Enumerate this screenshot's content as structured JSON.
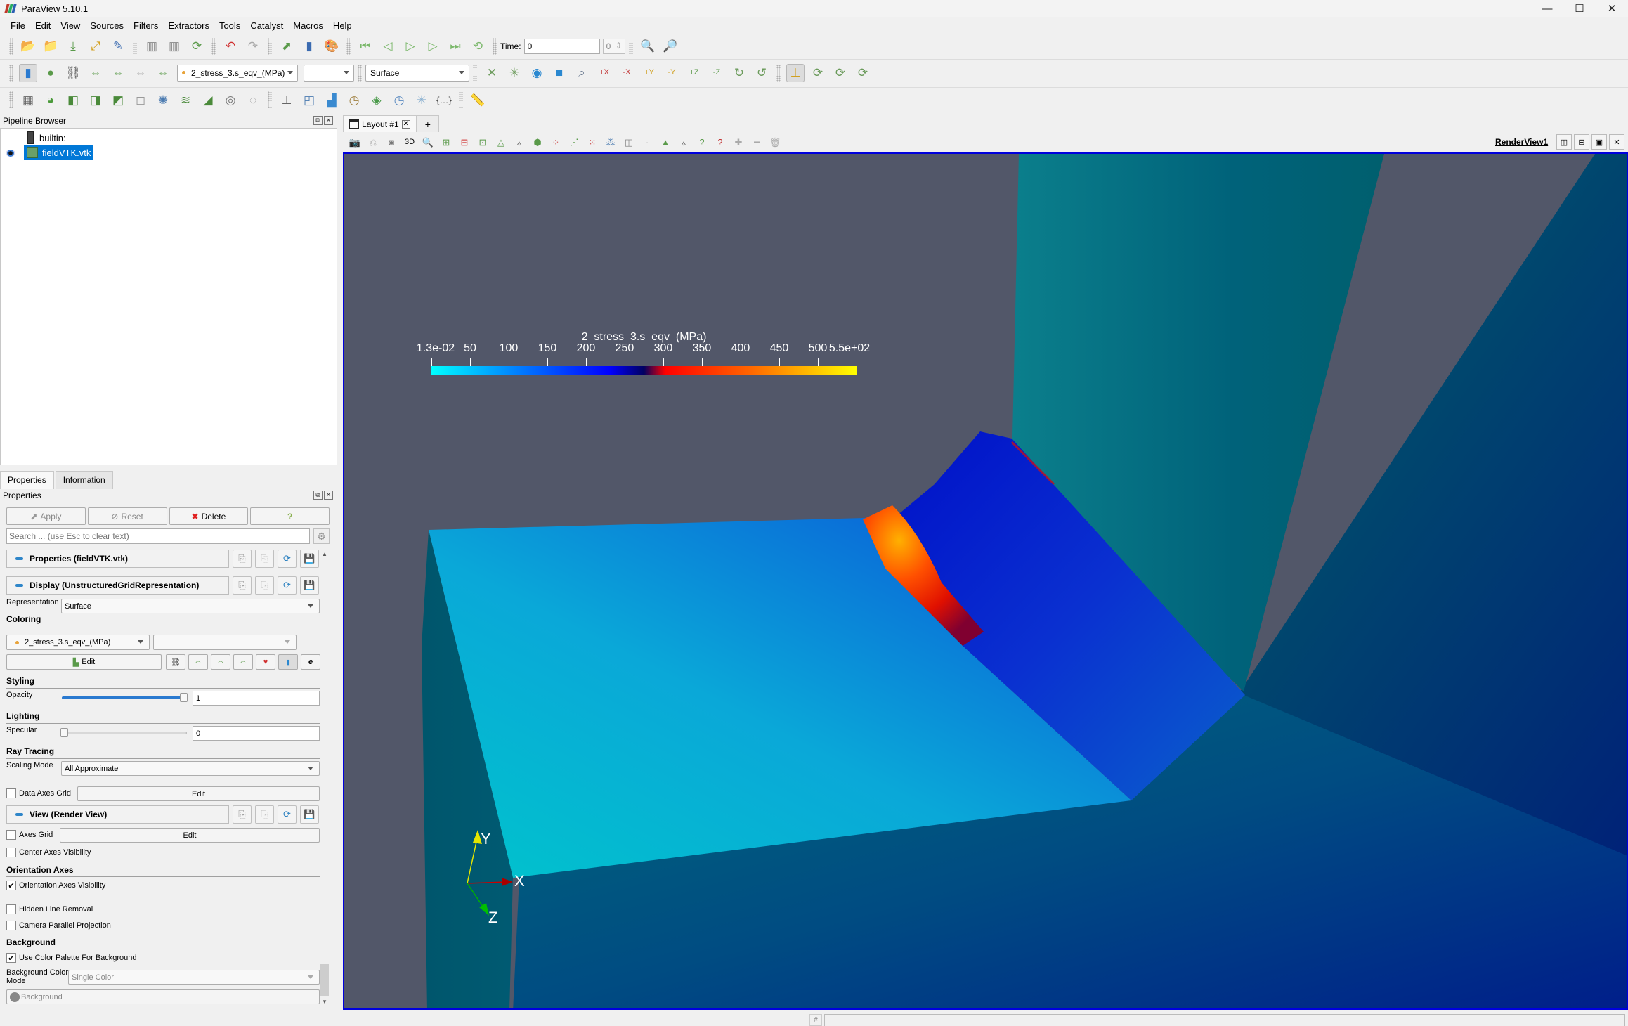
{
  "window": {
    "title": "ParaView 5.10.1",
    "controls": [
      "minimize",
      "maximize",
      "close"
    ]
  },
  "menu": [
    "File",
    "Edit",
    "View",
    "Sources",
    "Filters",
    "Extractors",
    "Tools",
    "Catalyst",
    "Macros",
    "Help"
  ],
  "toolbar_main": {
    "icons": [
      "open-icon",
      "load-state-icon",
      "save-data-icon",
      "reset-session-icon",
      "paraview-python-icon",
      "connect-icon",
      "disconnect-icon",
      "auto-apply-icon",
      "undo-icon",
      "redo-icon",
      "find-data-icon",
      "color-map-icon",
      "palette-icon"
    ],
    "vcr": [
      "first-frame-icon",
      "previous-frame-icon",
      "play-icon",
      "next-frame-icon",
      "last-frame-icon",
      "loop-icon"
    ],
    "time_label": "Time:",
    "time_value": "0",
    "time_index": "0"
  },
  "toolbar_display": {
    "color_array": "2_stress_3.s_eqv_(MPa)",
    "component": "",
    "representation": "Surface"
  },
  "pipeline": {
    "header": "Pipeline Browser",
    "items": [
      {
        "label": "builtin:",
        "type": "server"
      },
      {
        "label": "fieldVTK.vtk",
        "type": "source",
        "selected": true,
        "visible": true
      }
    ]
  },
  "panel_tabs": [
    {
      "label": "Properties",
      "active": true
    },
    {
      "label": "Information",
      "active": false
    }
  ],
  "properties": {
    "header": "Properties",
    "buttons": {
      "apply": "Apply",
      "reset": "Reset",
      "delete": "Delete",
      "help": "?"
    },
    "search_placeholder": "Search ... (use Esc to clear text)",
    "sections": {
      "properties": "Properties (fieldVTK.vtk)",
      "display": "Display (UnstructuredGridRepresentation)",
      "view": "View (Render View)"
    },
    "representation_label": "Representation",
    "representation_value": "Surface",
    "coloring_group": "Coloring",
    "coloring_array": "2_stress_3.s_eqv_(MPa)",
    "coloring_component": "",
    "edit_label": "Edit",
    "styling_group": "Styling",
    "opacity_label": "Opacity",
    "opacity_value": "1",
    "opacity_fraction": 1.0,
    "lighting_group": "Lighting",
    "specular_label": "Specular",
    "specular_value": "0",
    "specular_fraction": 0.0,
    "raytracing_group": "Ray Tracing",
    "scaling_mode_label": "Scaling Mode",
    "scaling_mode_value": "All Approximate",
    "data_axes_grid_label": "Data Axes Grid",
    "data_axes_grid_checked": false,
    "axes_grid_label": "Axes Grid",
    "axes_grid_checked": false,
    "center_axes_label": "Center Axes Visibility",
    "center_axes_checked": false,
    "orientation_group": "Orientation Axes",
    "orientation_visibility_label": "Orientation Axes Visibility",
    "orientation_visibility_checked": true,
    "hidden_line_label": "Hidden Line Removal",
    "hidden_line_checked": false,
    "parallel_projection_label": "Camera Parallel Projection",
    "parallel_projection_checked": false,
    "background_group": "Background",
    "use_palette_label": "Use Color Palette For Background",
    "use_palette_checked": true,
    "bg_mode_label": "Background Color Mode",
    "bg_mode_value": "Single Color",
    "background_button": "Background"
  },
  "layout": {
    "tab_label": "Layout #1",
    "add_tab": "+",
    "view_name": "RenderView1",
    "view_3d_label": "3D"
  },
  "render": {
    "background_color": "#525769",
    "legend": {
      "title": "2_stress_3.s_eqv_(MPa)",
      "range": [
        0.013,
        550
      ],
      "tick_labels": [
        "1.3e-02",
        "50",
        "100",
        "150",
        "200",
        "250",
        "300",
        "350",
        "400",
        "450",
        "500",
        "5.5e+02"
      ],
      "tick_values": [
        0.013,
        50,
        100,
        150,
        200,
        250,
        300,
        350,
        400,
        450,
        500,
        550
      ],
      "colormap": [
        "#00ffff",
        "#0080ff",
        "#0000ff",
        "#000060",
        "#ff0000",
        "#ff6600",
        "#ffff00"
      ]
    },
    "orientation_axes": {
      "x": "X",
      "y": "Y",
      "z": "Z",
      "x_color": "#cc0000",
      "y_color": "#e6e600",
      "z_color": "#00b000"
    }
  }
}
